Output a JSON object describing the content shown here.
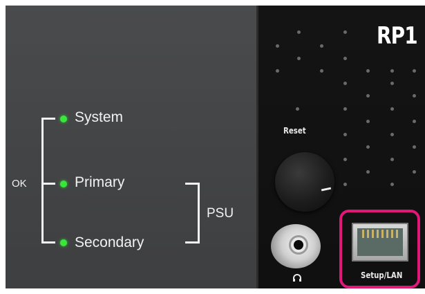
{
  "device": {
    "brand": "RP1",
    "reset_label": "Reset",
    "lan_label": "Setup/LAN",
    "headphone_icon": "headphone-icon"
  },
  "leds": {
    "ok_label": "OK",
    "system_label": "System",
    "primary_label": "Primary",
    "secondary_label": "Secondary",
    "psu_label": "PSU",
    "led_color": "#39e63a"
  },
  "highlight": {
    "color": "#e0187a"
  }
}
